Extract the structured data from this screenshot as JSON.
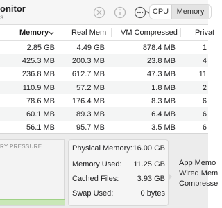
{
  "toolbar": {
    "title": "onitor",
    "subtitle": "s",
    "stop_icon": "stop-x-icon",
    "info_icon": "info-icon",
    "more_icon": "more-ellipsis-icon",
    "tabs": [
      {
        "label": "CPU",
        "selected": false
      },
      {
        "label": "Memory",
        "selected": true
      }
    ]
  },
  "table": {
    "columns": [
      "Memory",
      "Real Mem",
      "VM Compressed",
      "Privat"
    ],
    "rows": [
      {
        "memory": "2.85 GB",
        "real_mem": "4.49 GB",
        "vm_compressed": "878.4 MB",
        "private": "1"
      },
      {
        "memory": "425.3 MB",
        "real_mem": "200.3 MB",
        "vm_compressed": "23.8 MB",
        "private": "4"
      },
      {
        "memory": "236.8 MB",
        "real_mem": "612.7 MB",
        "vm_compressed": "47.3 MB",
        "private": "11"
      },
      {
        "memory": "110.9 MB",
        "real_mem": "57.2 MB",
        "vm_compressed": "1.8 MB",
        "private": "2"
      },
      {
        "memory": "78.6 MB",
        "real_mem": "176.4 MB",
        "vm_compressed": "8.3 MB",
        "private": "6"
      },
      {
        "memory": "60.1 MB",
        "real_mem": "89.3 MB",
        "vm_compressed": "6.4 MB",
        "private": "6"
      },
      {
        "memory": "56.1 MB",
        "real_mem": "95.7 MB",
        "vm_compressed": "3.5 MB",
        "private": "6"
      }
    ]
  },
  "pressure": {
    "label": "RY PRESSURE",
    "level_fraction": 0.1,
    "fill_color": "#c9e7b7"
  },
  "stats": [
    {
      "label": "Physical Memory:",
      "value": "16.00 GB"
    },
    {
      "label": "Memory Used:",
      "value": "11.25 GB"
    },
    {
      "label": "Cached Files:",
      "value": "3.93 GB"
    },
    {
      "label": "Swap Used:",
      "value": "0 bytes"
    }
  ],
  "breakdown": [
    "App Memo",
    "Wired Mem",
    "Compresse"
  ]
}
